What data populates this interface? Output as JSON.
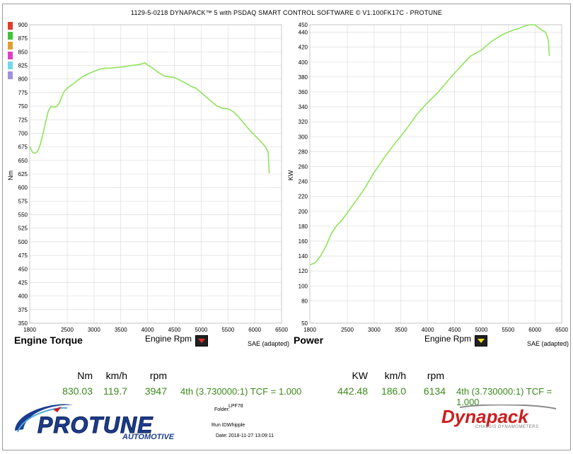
{
  "window_title": "1129-5-0218 DYNAPACK™ 5 with PSDAQ SMART CONTROL SOFTWARE © V1.100FK17C - PROTUNE",
  "colors": {
    "curve": "#8fe35a",
    "grid": "#d8d8d8",
    "readout_green": "#3a8a1a",
    "logo_blue": "#1c3d8f",
    "logo_red": "#cc1e1e"
  },
  "legend_swatches": [
    "#e53a2a",
    "#43c23a",
    "#e0a030",
    "#e040c0",
    "#70d8e8",
    "#a090e0"
  ],
  "torque": {
    "chart_title": "Engine Torque",
    "x_axis_label": "Engine Rpm",
    "y_axis_label": "Nm",
    "standard": "SAE (adapted)",
    "button_icon": "red-down-triangle"
  },
  "power": {
    "chart_title": "Power",
    "x_axis_label": "Engine Rpm",
    "y_axis_label": "KW",
    "standard": "SAE (adapted)",
    "button_icon": "yellow-down-triangle"
  },
  "readout_left": {
    "h1": "Nm",
    "h2": "km/h",
    "h3": "rpm",
    "v1": "830.03",
    "v2": "119.7",
    "v3": "3947",
    "gear": "4th (3.730000:1) TCF = 1.000"
  },
  "readout_right": {
    "h1": "KW",
    "h2": "km/h",
    "h3": "rpm",
    "v1": "442.48",
    "v2": "186.0",
    "v3": "6134",
    "gear": "4th (3.730000:1) TCF = 1.000"
  },
  "info": {
    "folder_label": "Folder:",
    "folder": "LPF78",
    "run_label": "Run ID:",
    "run": "Whipple",
    "date_label": "Date:",
    "date": "2018-11-27 13:09:11"
  },
  "logo_left": {
    "main": "PROTUNE",
    "sub": "AUTOMOTIVE"
  },
  "logo_right": {
    "main": "Dynapack",
    "sub": "CHASSIS DYNAMOMETERS"
  },
  "chart_data": [
    {
      "type": "line",
      "xlabel": "Engine Rpm",
      "ylabel": "Nm",
      "xlim": [
        1800,
        6500
      ],
      "ylim": [
        350,
        900
      ],
      "xticks": [
        1800,
        2500,
        3000,
        3500,
        4000,
        4500,
        5000,
        5500,
        6000,
        6500
      ],
      "yticks": [
        350,
        375,
        400,
        425,
        450,
        475,
        500,
        525,
        550,
        575,
        600,
        625,
        650,
        675,
        700,
        725,
        750,
        775,
        800,
        825,
        850,
        875,
        900
      ],
      "grid": true,
      "series": [
        {
          "color": "#8fe35a",
          "x": [
            1800,
            1850,
            1900,
            1950,
            2000,
            2050,
            2100,
            2150,
            2200,
            2250,
            2300,
            2350,
            2400,
            2450,
            2500,
            2550,
            2600,
            2700,
            2800,
            2900,
            3000,
            3100,
            3200,
            3300,
            3400,
            3500,
            3600,
            3700,
            3800,
            3900,
            3947,
            4000,
            4100,
            4200,
            4300,
            4400,
            4500,
            4600,
            4700,
            4800,
            4900,
            5000,
            5100,
            5200,
            5300,
            5400,
            5500,
            5600,
            5700,
            5800,
            5900,
            6000,
            6100,
            6200,
            6250,
            6270
          ],
          "values": [
            675,
            665,
            663,
            667,
            680,
            700,
            722,
            742,
            750,
            748,
            749,
            755,
            768,
            778,
            783,
            787,
            790,
            798,
            805,
            810,
            814,
            818,
            820,
            820,
            821,
            822,
            823,
            825,
            826,
            828,
            830,
            826,
            820,
            812,
            806,
            804,
            803,
            798,
            793,
            787,
            783,
            775,
            766,
            758,
            750,
            746,
            745,
            740,
            730,
            718,
            706,
            696,
            686,
            675,
            665,
            626
          ]
        }
      ]
    },
    {
      "type": "line",
      "xlabel": "Engine Rpm",
      "ylabel": "KW",
      "xlim": [
        1800,
        6500
      ],
      "ylim": [
        50,
        450
      ],
      "xticks": [
        1800,
        2500,
        3000,
        3500,
        4000,
        4500,
        5000,
        5500,
        6000,
        6500
      ],
      "yticks": [
        50,
        80,
        100,
        120,
        140,
        160,
        180,
        200,
        220,
        240,
        260,
        280,
        300,
        320,
        340,
        360,
        380,
        400,
        420,
        440,
        450
      ],
      "grid": true,
      "series": [
        {
          "color": "#8fe35a",
          "x": [
            1800,
            1900,
            2000,
            2100,
            2200,
            2300,
            2400,
            2500,
            2600,
            2700,
            2800,
            2900,
            3000,
            3200,
            3400,
            3600,
            3800,
            4000,
            4200,
            4400,
            4600,
            4800,
            5000,
            5200,
            5400,
            5600,
            5700,
            5800,
            5900,
            6000,
            6134,
            6200,
            6250,
            6270
          ],
          "values": [
            128,
            131,
            140,
            153,
            170,
            181,
            188,
            198,
            208,
            218,
            228,
            240,
            252,
            273,
            292,
            310,
            330,
            346,
            360,
            377,
            393,
            408,
            416,
            428,
            437,
            443,
            445,
            448,
            450,
            450,
            442.48,
            440,
            430,
            408
          ]
        }
      ]
    }
  ]
}
